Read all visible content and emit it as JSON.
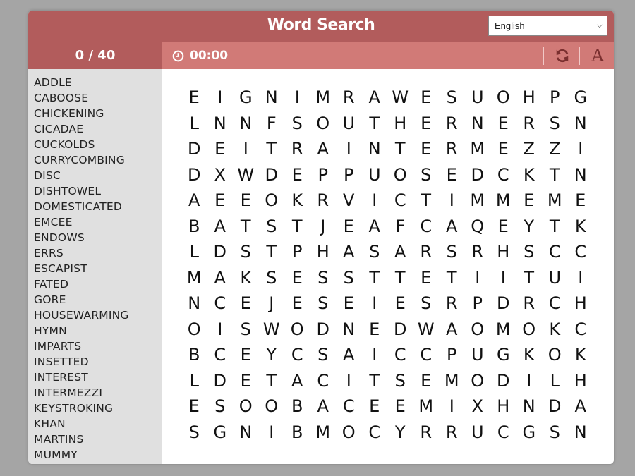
{
  "header": {
    "title": "Word Search",
    "language": "English"
  },
  "toolbar": {
    "found_count": "0 / 40",
    "timer": "00:00",
    "refresh_icon": "refresh-icon",
    "font_label": "A"
  },
  "colors": {
    "header": "#b25c5c",
    "toolbar": "#d17a77",
    "sidebar": "#e0e0e0",
    "page_bg": "#a5a5a5"
  },
  "words": [
    "ADDLE",
    "CABOOSE",
    "CHICKENING",
    "CICADAE",
    "CUCKOLDS",
    "CURRYCOMBING",
    "DISC",
    "DISHTOWEL",
    "DOMESTICATED",
    "EMCEE",
    "ENDOWS",
    "ERRS",
    "ESCAPIST",
    "FATED",
    "GORE",
    "HOUSEWARMING",
    "HYMN",
    "IMPARTS",
    "INSETTED",
    "INTEREST",
    "INTERMEZZI",
    "KEYSTROKING",
    "KHAN",
    "MARTINS",
    "MUMMY"
  ],
  "grid": [
    "EIGNIMRAWESUOHPG",
    "LNNFSOUTHERNERSN",
    "DEITRAINTERMEZZI",
    "DXWDEPPUOSEDCKTN",
    "AEEOKRVICTIMMEME",
    "BATSTJEAFCAQEYTK",
    "LDSTPHASARSRHSCC",
    "MAKSESSTTETIITUI",
    "NCEJESEIESRPDRCH",
    "OISWODNEDWAOMOKC",
    "BCEYCSAICCPUGKOK",
    "LDETACITSEMODILH",
    "ESOOBACEEMIXHNDA",
    "SGNIBMOCYRRUCGSN"
  ]
}
